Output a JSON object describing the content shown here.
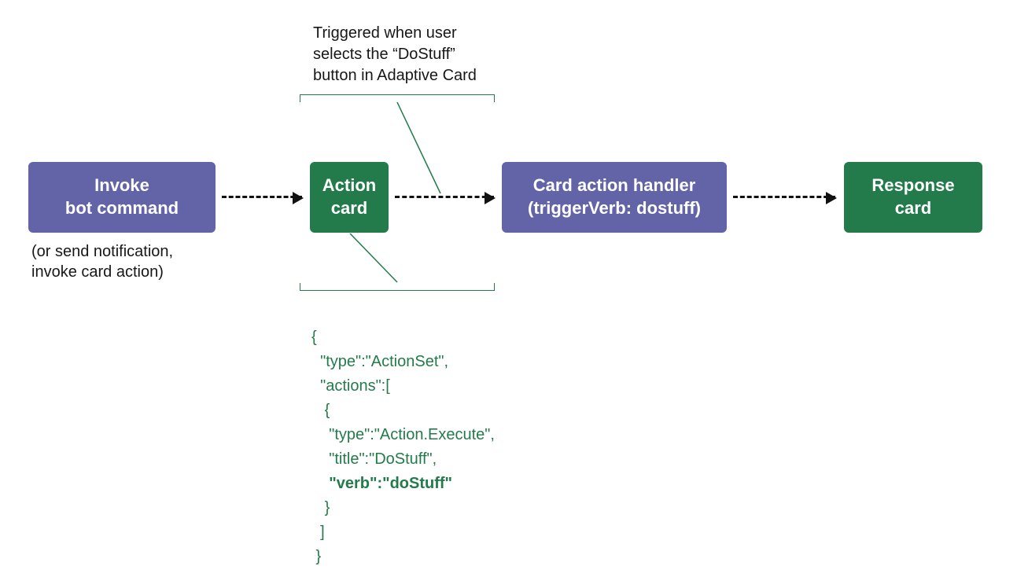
{
  "nodes": {
    "invoke": {
      "line1": "Invoke",
      "line2": "bot command"
    },
    "action_card": {
      "line1": "Action",
      "line2": "card"
    },
    "handler": {
      "line1": "Card action handler",
      "line2": "(triggerVerb: dostuff)"
    },
    "response": {
      "line1": "Response",
      "line2": "card"
    }
  },
  "subtext": {
    "line1": "(or send notification,",
    "line2": "invoke card action)"
  },
  "callout": {
    "line1": "Triggered when user",
    "line2": "selects the “DoStuff”",
    "line3": "button in Adaptive Card"
  },
  "code": {
    "l1": "{",
    "l2": "  \"type\":\"ActionSet\",",
    "l3": "  \"actions\":[",
    "l4": "   {",
    "l5": "    \"type\":\"Action.Execute\",",
    "l6": "    \"title\":\"DoStuff\",",
    "l7_pre": "    ",
    "l7_bold": "\"verb\":\"doStuff\"",
    "l8": "   }",
    "l9": "  ]",
    "l10": " }"
  },
  "colors": {
    "purple": "#6264a7",
    "green": "#237b4b"
  }
}
